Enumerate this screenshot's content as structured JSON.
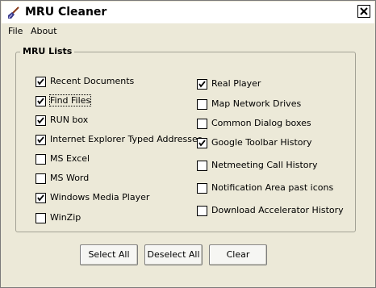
{
  "window": {
    "title": "MRU Cleaner"
  },
  "menu": [
    "File",
    "About"
  ],
  "group": {
    "title": "MRU Lists"
  },
  "left_checks": [
    {
      "label": "Recent Documents",
      "checked": true
    },
    {
      "label": "Find Files",
      "checked": true
    },
    {
      "label": "RUN box",
      "checked": true
    },
    {
      "label": "Internet Explorer Typed Addresses",
      "checked": true
    },
    {
      "label": "MS Excel",
      "checked": false
    },
    {
      "label": "MS Word",
      "checked": false
    },
    {
      "label": "Windows Media Player",
      "checked": true
    },
    {
      "label": "WinZip",
      "checked": false
    }
  ],
  "right_checks": [
    {
      "label": "Real Player",
      "checked": true
    },
    {
      "label": "Map Network Drives",
      "checked": false
    },
    {
      "label": "Common Dialog boxes",
      "checked": false
    },
    {
      "label": "Google Toolbar History",
      "checked": true
    },
    {
      "label": "Netmeeting Call History",
      "checked": false
    },
    {
      "label": "Notification Area past icons",
      "checked": false
    },
    {
      "label": "Download Accelerator History",
      "checked": false
    }
  ],
  "buttons": {
    "select_all": "Select All",
    "deselect_all": "Deselect All",
    "clear": "Clear"
  }
}
